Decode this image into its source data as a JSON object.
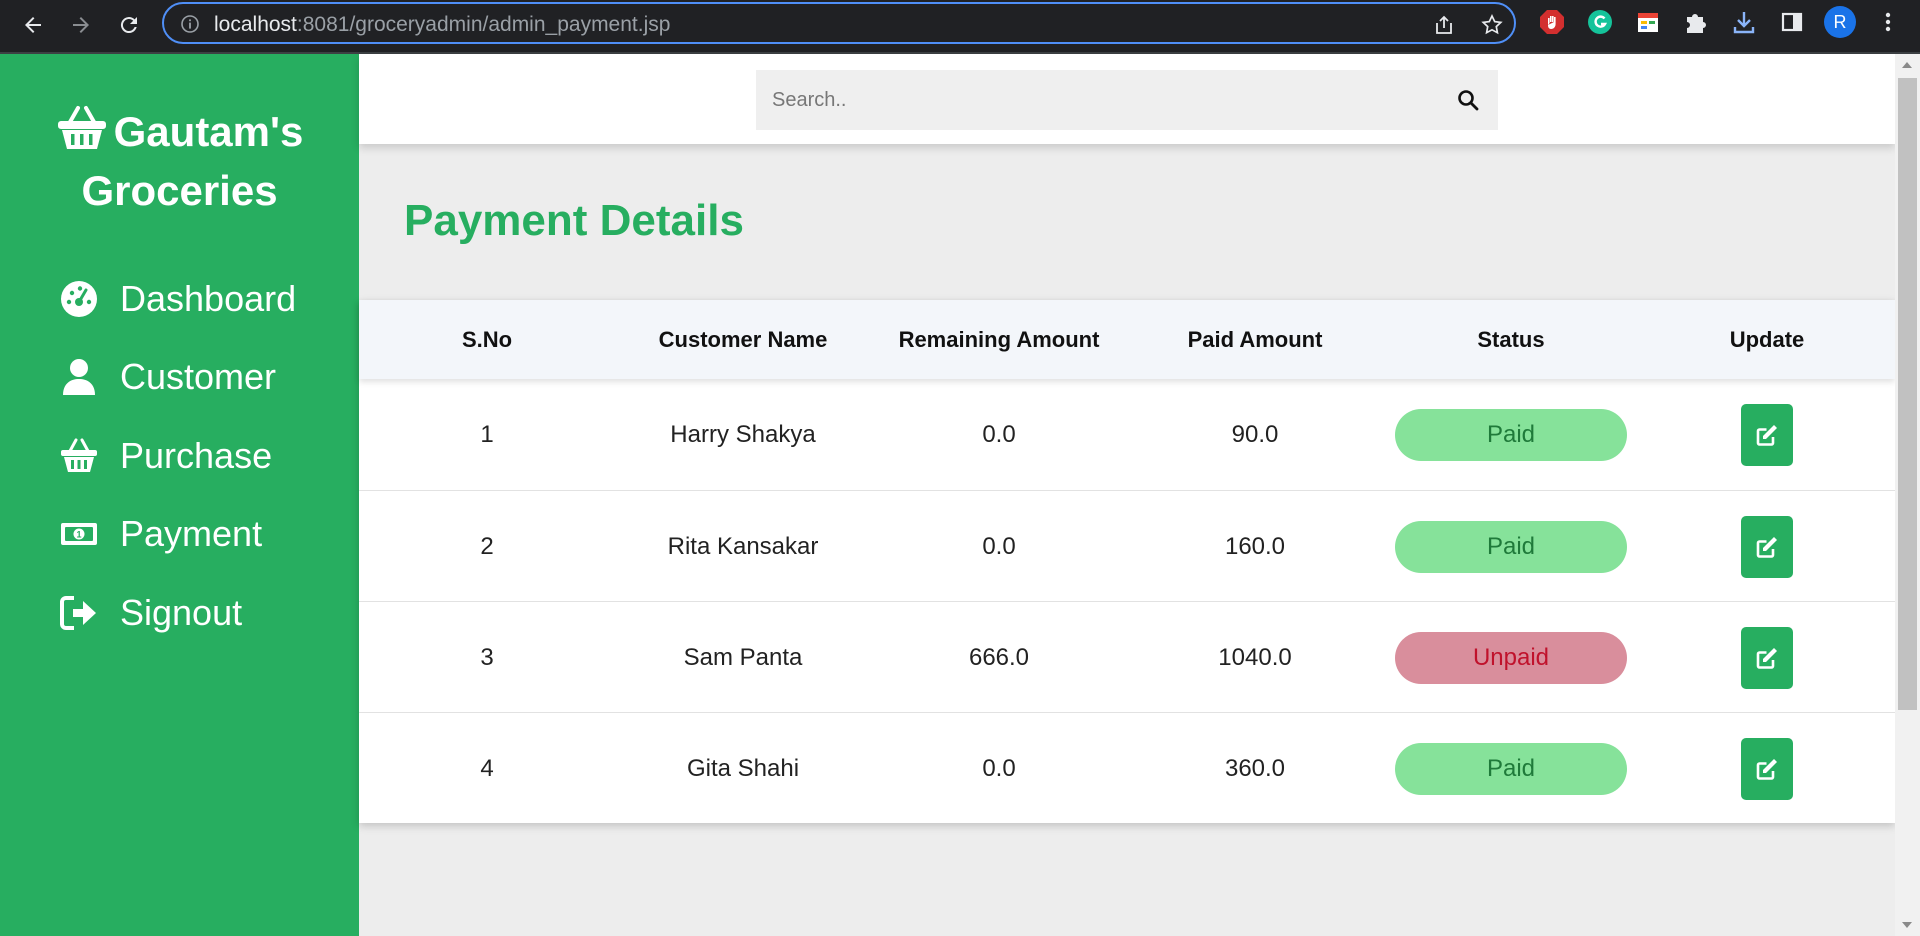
{
  "browser": {
    "url_host": "localhost",
    "url_rest": ":8081/groceryadmin/admin_payment.jsp",
    "avatar_initial": "R"
  },
  "sidebar": {
    "brand": "Gautam's Groceries",
    "items": [
      {
        "label": "Dashboard",
        "icon": "dashboard-icon"
      },
      {
        "label": "Customer",
        "icon": "user-icon"
      },
      {
        "label": "Purchase",
        "icon": "basket-icon"
      },
      {
        "label": "Payment",
        "icon": "money-icon"
      },
      {
        "label": "Signout",
        "icon": "signout-icon"
      }
    ]
  },
  "search": {
    "placeholder": "Search.."
  },
  "page": {
    "title": "Payment Details"
  },
  "table": {
    "headers": [
      "S.No",
      "Customer Name",
      "Remaining Amount",
      "Paid Amount",
      "Status",
      "Update"
    ],
    "rows": [
      {
        "sno": "1",
        "name": "Harry Shakya",
        "remaining": "0.0",
        "paid": "90.0",
        "status": "Paid"
      },
      {
        "sno": "2",
        "name": "Rita Kansakar",
        "remaining": "0.0",
        "paid": "160.0",
        "status": "Paid"
      },
      {
        "sno": "3",
        "name": "Sam Panta",
        "remaining": "666.0",
        "paid": "1040.0",
        "status": "Unpaid"
      },
      {
        "sno": "4",
        "name": "Gita Shahi",
        "remaining": "0.0",
        "paid": "360.0",
        "status": "Paid"
      }
    ]
  },
  "colors": {
    "brand_green": "#27ae60",
    "paid_bg": "#86e29a",
    "unpaid_bg": "#d98e9c",
    "unpaid_text": "#c0122c"
  }
}
